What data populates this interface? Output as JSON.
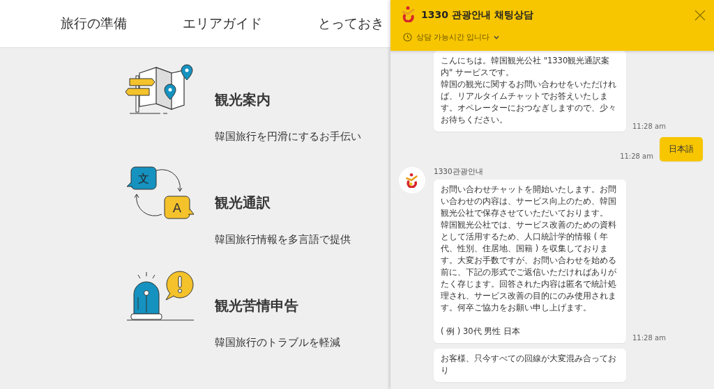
{
  "nav": {
    "items": [
      {
        "label": "旅行の準備"
      },
      {
        "label": "エリアガイド"
      },
      {
        "label": "とっておき"
      }
    ]
  },
  "services": [
    {
      "kind": "map",
      "title": "観光案内",
      "description": "韓国旅行を円滑にするお手伝い"
    },
    {
      "kind": "translate",
      "icon_texts": [
        "文",
        "A"
      ],
      "title": "観光通訳",
      "description": "韓国旅行情報を多言語で提供"
    },
    {
      "kind": "alert",
      "title": "観光苦情申告",
      "description": "韓国旅行のトラブルを軽減"
    }
  ],
  "chat": {
    "title": "1330 관광안내 채팅상담",
    "status": "상담 가능시간 입니다",
    "messages": [
      {
        "kind": "bot",
        "paragraphs": [
          "こんにちは。韓国観光公社 \"1330観光通訳案内\" サービスです。",
          "韓国の観光に関するお問い合わせをいただければ、リアルタイムチャットでお答えいたします。オペレーターにおつなぎしますので、少々お待ちください。"
        ],
        "time": "11:28 am"
      },
      {
        "kind": "user",
        "paragraphs": [
          "日本語"
        ],
        "time": "11:28 am"
      },
      {
        "kind": "bot",
        "sender": "1330관광안내",
        "paragraphs": [
          "お問い合わせチャットを開始いたします。お問い合わせの内容は、サービス向上のため、韓国観光公社で保存させていただいております。",
          "韓国観光公社では、サービス改善のための資料として活用するため、人口統計学的情報 ( 年代、性別、住居地、国籍 ) を収集しております。大変お手数ですが、お問い合わせを始める前に、下記の形式でご返信いただければありがたく存じます。回答された内容は匿名で統計処理され、サービス改善の目的にのみ使用されます。何卒ご協力をお願い申し上げます。"
        ],
        "example": "( 例 ) 30代 男性 日本",
        "time": "11:28 am"
      },
      {
        "kind": "bot",
        "paragraphs": [
          "お客様、只今すべての回線が大変混み合っており"
        ]
      }
    ]
  }
}
